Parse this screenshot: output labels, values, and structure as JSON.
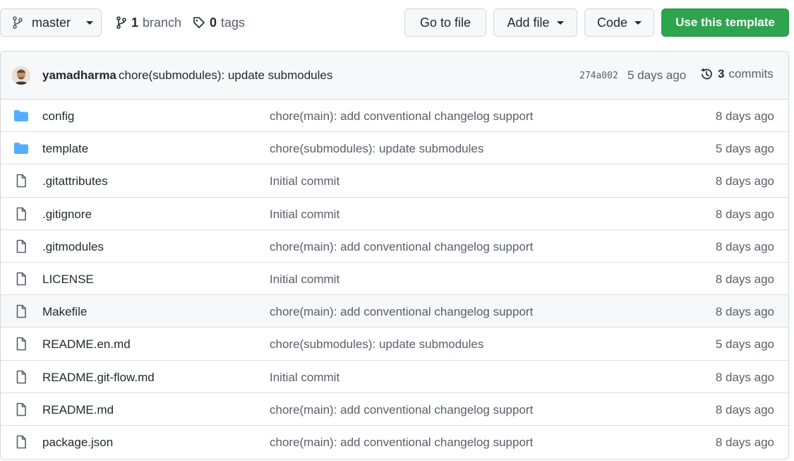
{
  "toolbar": {
    "branch_name": "master",
    "branch_count": "1",
    "branch_label": "branch",
    "tag_count": "0",
    "tag_label": "tags",
    "go_to_file": "Go to file",
    "add_file": "Add file",
    "code": "Code",
    "use_template": "Use this template"
  },
  "commit": {
    "author": "yamadharma",
    "message": "chore(submodules): update submodules",
    "sha": "274a002",
    "age": "5 days ago",
    "count": "3",
    "count_label": "commits"
  },
  "files": [
    {
      "name": "config",
      "type": "folder",
      "message": "chore(main): add conventional changelog support",
      "age": "8 days ago"
    },
    {
      "name": "template",
      "type": "folder",
      "message": "chore(submodules): update submodules",
      "age": "5 days ago"
    },
    {
      "name": ".gitattributes",
      "type": "file",
      "message": "Initial commit",
      "age": "8 days ago"
    },
    {
      "name": ".gitignore",
      "type": "file",
      "message": "Initial commit",
      "age": "8 days ago"
    },
    {
      "name": ".gitmodules",
      "type": "file",
      "message": "chore(main): add conventional changelog support",
      "age": "8 days ago"
    },
    {
      "name": "LICENSE",
      "type": "file",
      "message": "Initial commit",
      "age": "8 days ago"
    },
    {
      "name": "Makefile",
      "type": "file",
      "message": "chore(main): add conventional changelog support",
      "age": "8 days ago"
    },
    {
      "name": "README.en.md",
      "type": "file",
      "message": "chore(submodules): update submodules",
      "age": "5 days ago"
    },
    {
      "name": "README.git-flow.md",
      "type": "file",
      "message": "Initial commit",
      "age": "8 days ago"
    },
    {
      "name": "README.md",
      "type": "file",
      "message": "chore(main): add conventional changelog support",
      "age": "8 days ago"
    },
    {
      "name": "package.json",
      "type": "file",
      "message": "chore(main): add conventional changelog support",
      "age": "8 days ago"
    }
  ],
  "colors": {
    "accent_green": "#2da44e",
    "folder_blue": "#54aeff",
    "muted_text": "#57606a"
  }
}
